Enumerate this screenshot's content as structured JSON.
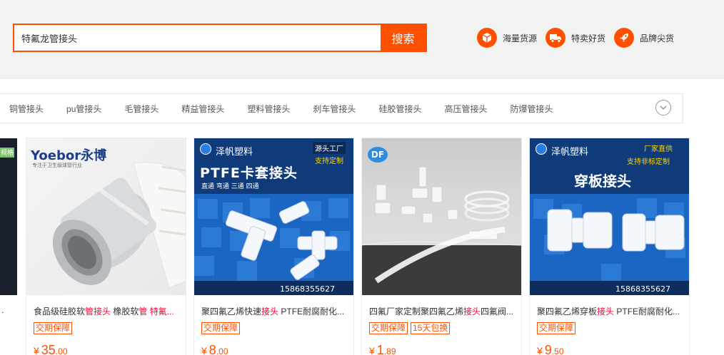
{
  "search": {
    "query": "特氟龙管接头",
    "button_label": "搜索"
  },
  "features": [
    {
      "label": "海量货源",
      "icon": "box-icon"
    },
    {
      "label": "特卖好货",
      "icon": "truck-icon"
    },
    {
      "label": "品牌尖货",
      "icon": "rocket-icon"
    }
  ],
  "categories": [
    "铜管接头",
    "pu管接头",
    "毛管接头",
    "精益管接头",
    "塑料管接头",
    "刹车管接头",
    "硅胶管接头",
    "高压管接头",
    "防爆管接头"
  ],
  "left_partial": {
    "tag": "规格",
    "dot": "."
  },
  "products": [
    {
      "title_parts": [
        "食品级硅胶软",
        "管接头",
        " 橡胶软",
        "管",
        " 特氟..."
      ],
      "tags": [
        "交期保障"
      ],
      "price_currency": "¥",
      "price_int": "35",
      "price_dec": ".00",
      "image": {
        "brand": "Yoebor永博",
        "subtitle": "专注于卫生级球管行业"
      }
    },
    {
      "title_parts": [
        "聚四氟乙烯快速",
        "接头",
        " PTFE耐腐耐化..."
      ],
      "tags": [
        "交期保障"
      ],
      "price_currency": "¥",
      "price_int": "8",
      "price_dec": ".00",
      "image": {
        "brand": "泽帆塑料",
        "badge1": "源头工厂",
        "badge2": "支持定制",
        "headline": "PTFE卡套接头",
        "sub": "直通  弯通  三通  四通",
        "phone": "15868355627"
      }
    },
    {
      "title_parts": [
        "四氟厂家定制聚四氟乙烯",
        "接头",
        "四氟阀..."
      ],
      "tags": [
        "交期保障",
        "15天包换"
      ],
      "price_currency": "¥",
      "price_int": "1",
      "price_dec": ".89",
      "image": {
        "brand": "DF"
      }
    },
    {
      "title_parts": [
        "聚四氟乙烯穿板",
        "接头",
        " PTFE耐腐耐化..."
      ],
      "tags": [
        "交期保障"
      ],
      "price_currency": "¥",
      "price_int": "9",
      "price_dec": ".50",
      "image": {
        "brand": "泽帆塑料",
        "badge1": "厂家直供",
        "badge2": "支持非标定制",
        "headline": "穿板接头",
        "phone": "15868355627"
      }
    }
  ],
  "colors": {
    "accent": "#ff5000",
    "highlight": "#ff0036"
  }
}
